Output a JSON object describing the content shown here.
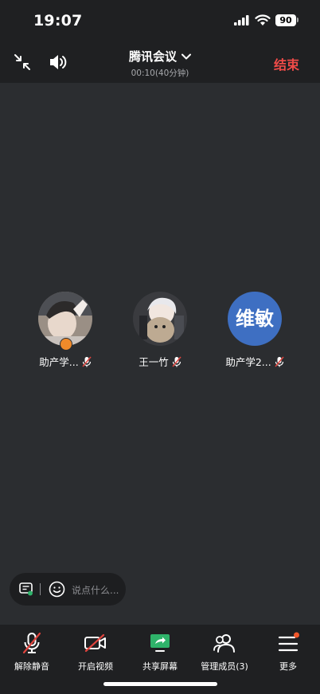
{
  "status_bar": {
    "time": "19:07",
    "battery": "90",
    "icons": [
      "cellular-signal-icon",
      "wifi-icon",
      "battery-icon"
    ]
  },
  "header": {
    "title": "腾讯会议",
    "subtitle": "00:10(40分钟)",
    "end_label": "结束",
    "end_color": "#f04b48",
    "icons": [
      "collapse-icon",
      "speaker-icon",
      "chevron-down-icon"
    ]
  },
  "participants": [
    {
      "name": "助产学...",
      "avatar": "photo",
      "muted": true,
      "host": true
    },
    {
      "name": "王一竹",
      "avatar": "photo",
      "muted": true,
      "host": false
    },
    {
      "name": "助产学2...",
      "avatar_text": "维敏",
      "avatar_color": "#3e6fc2",
      "muted": true,
      "host": false
    }
  ],
  "chat": {
    "placeholder": "说点什么..."
  },
  "toolbar": {
    "items": [
      {
        "label": "解除静音",
        "icon": "mic-muted-icon"
      },
      {
        "label": "开启视频",
        "icon": "video-off-icon"
      },
      {
        "label": "共享屏幕",
        "icon": "share-screen-icon"
      },
      {
        "label": "管理成员(3)",
        "icon": "members-icon"
      },
      {
        "label": "更多",
        "icon": "more-menu-icon"
      }
    ],
    "share_color": "#2fb36a",
    "badge_color": "#f0572b"
  }
}
